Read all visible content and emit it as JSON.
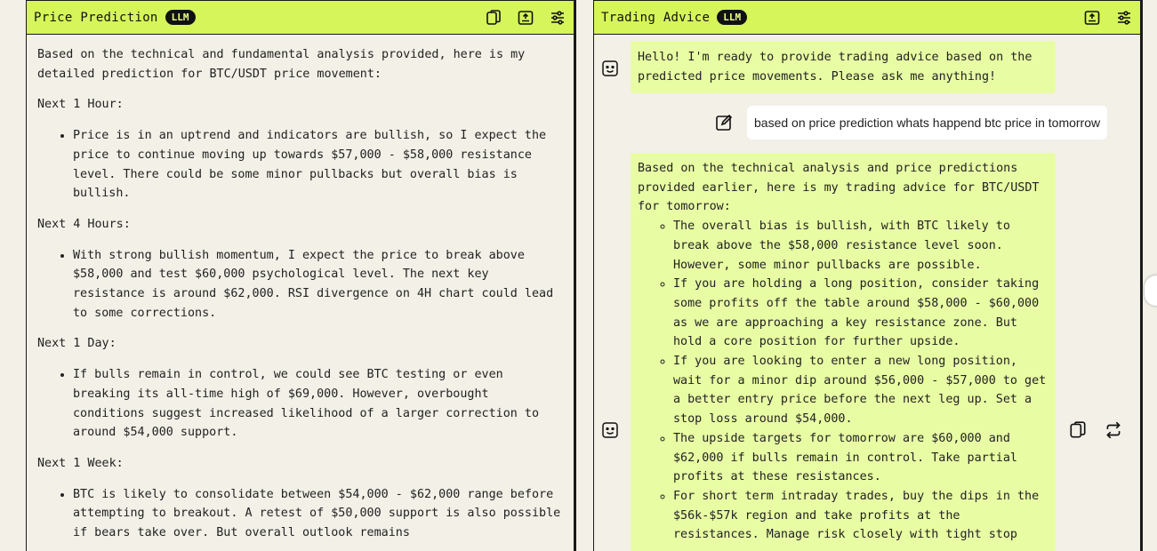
{
  "left_panel": {
    "title": "Price Prediction",
    "badge": "LLM",
    "intro": "Based on the technical and fundamental analysis provided, here is my detailed prediction for BTC/USDT price movement:",
    "sections": [
      {
        "heading": "Next 1 Hour:",
        "bullet": "Price is in an uptrend and indicators are bullish, so I expect the price to continue moving up towards $57,000 - $58,000 resistance level. There could be some minor pullbacks but overall bias is bullish."
      },
      {
        "heading": "Next 4 Hours:",
        "bullet": "With strong bullish momentum, I expect the price to break above $58,000 and test $60,000 psychological level. The next key resistance is around $62,000. RSI divergence on 4H chart could lead to some corrections."
      },
      {
        "heading": "Next 1 Day:",
        "bullet": "If bulls remain in control, we could see BTC testing or even breaking its all-time high of $69,000. However, overbought conditions suggest increased likelihood of a larger correction to around $54,000 support."
      },
      {
        "heading": "Next 1 Week:",
        "bullet": "BTC is likely to consolidate between $54,000 - $62,000 range before attempting to breakout. A retest of $50,000 support is also possible if bears take over. But overall outlook remains"
      }
    ]
  },
  "right_panel": {
    "title": "Trading Advice",
    "badge": "LLM",
    "greeting": "Hello! I'm ready to provide trading advice based on the predicted price movements. Please ask me anything!",
    "user_message": "based on price prediction whats happend btc price in tomorrow",
    "advice_intro": "Based on the technical analysis and price predictions provided earlier, here is my trading advice for BTC/USDT for tomorrow:",
    "advice_items": [
      "The overall bias is bullish, with BTC likely to break above the $58,000 resistance level soon. However, some minor pullbacks are possible.",
      "If you are holding a long position, consider taking some profits off the table around $58,000 - $60,000 as we are approaching a key resistance zone. But hold a core position for further upside.",
      "If you are looking to enter a new long position, wait for a minor dip around $56,000 - $57,000 to get a better entry price before the next leg up. Set a stop loss around $54,000.",
      "The upside targets for tomorrow are $60,000 and $62,000 if bulls remain in control. Take partial profits at these resistances.",
      "For short term intraday trades, buy the dips in the $56k-$57k region and take profits at the resistances. Manage risk closely with tight stop"
    ]
  },
  "icons": {
    "copy": "copy-icon",
    "export": "export-icon",
    "settings": "sliders-icon",
    "bot": "bot-face-icon",
    "edit": "edit-icon",
    "regenerate": "regenerate-icon"
  },
  "colors": {
    "accent": "#d6f55a",
    "bubble": "#e8fca4",
    "background": "#f2f0e7"
  }
}
